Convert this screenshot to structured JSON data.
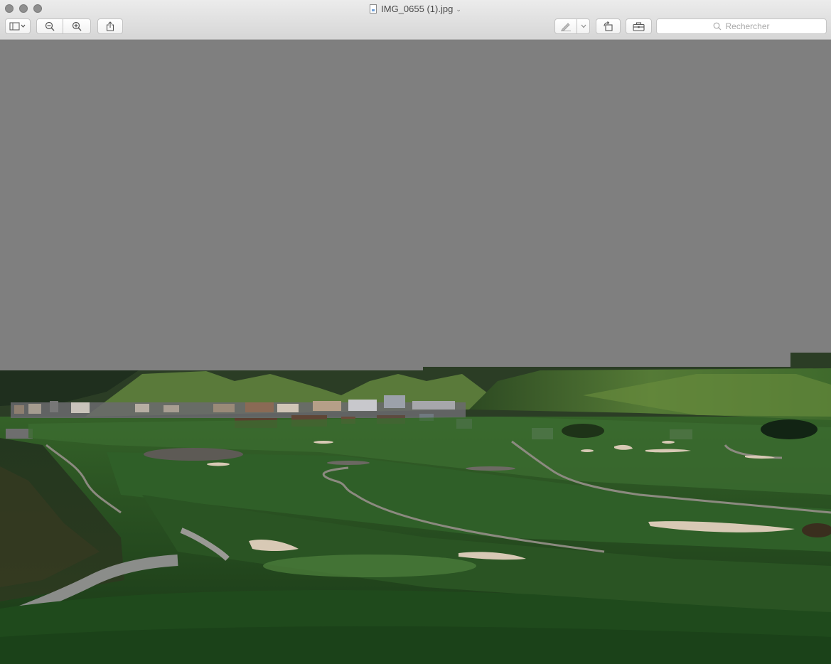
{
  "window": {
    "title": "IMG_0655 (1).jpg",
    "title_icon": "jpeg-document-icon"
  },
  "toolbar": {
    "sidebar_icon": "sidebar-icon",
    "zoom_out_icon": "zoom-out-icon",
    "zoom_in_icon": "zoom-in-icon",
    "share_icon": "share-icon",
    "markup_icon": "markup-pen-icon",
    "rotate_icon": "rotate-left-icon",
    "toolbox_icon": "toolbox-icon"
  },
  "search": {
    "placeholder": "Rechercher"
  },
  "colors": {
    "canvas_gray": "#7f7f7f",
    "grass_dark": "#1e3f1a",
    "grass_mid": "#2f5a26",
    "bunker_sand": "#d8c9b5"
  }
}
